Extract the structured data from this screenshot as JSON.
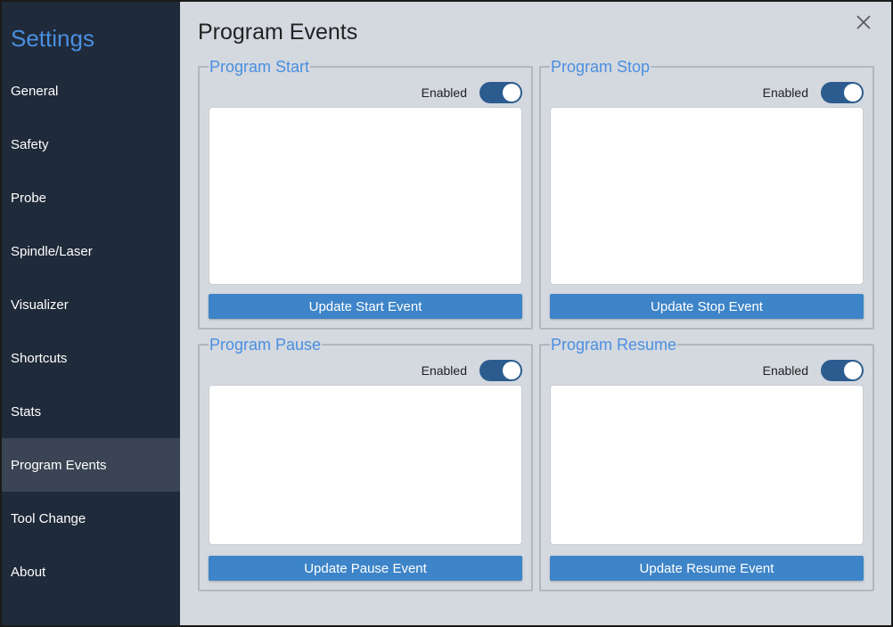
{
  "sidebar": {
    "title": "Settings",
    "items": [
      {
        "label": "General"
      },
      {
        "label": "Safety"
      },
      {
        "label": "Probe"
      },
      {
        "label": "Spindle/Laser"
      },
      {
        "label": "Visualizer"
      },
      {
        "label": "Shortcuts"
      },
      {
        "label": "Stats"
      },
      {
        "label": "Program Events",
        "active": true
      },
      {
        "label": "Tool Change"
      },
      {
        "label": "About"
      }
    ]
  },
  "main": {
    "title": "Program Events",
    "panels": [
      {
        "title": "Program Start",
        "enabled_label": "Enabled",
        "enabled": true,
        "event_text": "",
        "button_label": "Update Start Event"
      },
      {
        "title": "Program Stop",
        "enabled_label": "Enabled",
        "enabled": true,
        "event_text": "",
        "button_label": "Update Stop Event"
      },
      {
        "title": "Program Pause",
        "enabled_label": "Enabled",
        "enabled": true,
        "event_text": "",
        "button_label": "Update Pause Event"
      },
      {
        "title": "Program Resume",
        "enabled_label": "Enabled",
        "enabled": true,
        "event_text": "",
        "button_label": "Update Resume Event"
      }
    ]
  },
  "colors": {
    "sidebar_bg": "#1f2a3a",
    "sidebar_active": "#3a4454",
    "accent": "#4a8fe0",
    "button": "#3d84c8",
    "toggle_on": "#2c5c8f",
    "main_bg": "#d4d8df"
  },
  "icons": {
    "close": "close-icon"
  }
}
